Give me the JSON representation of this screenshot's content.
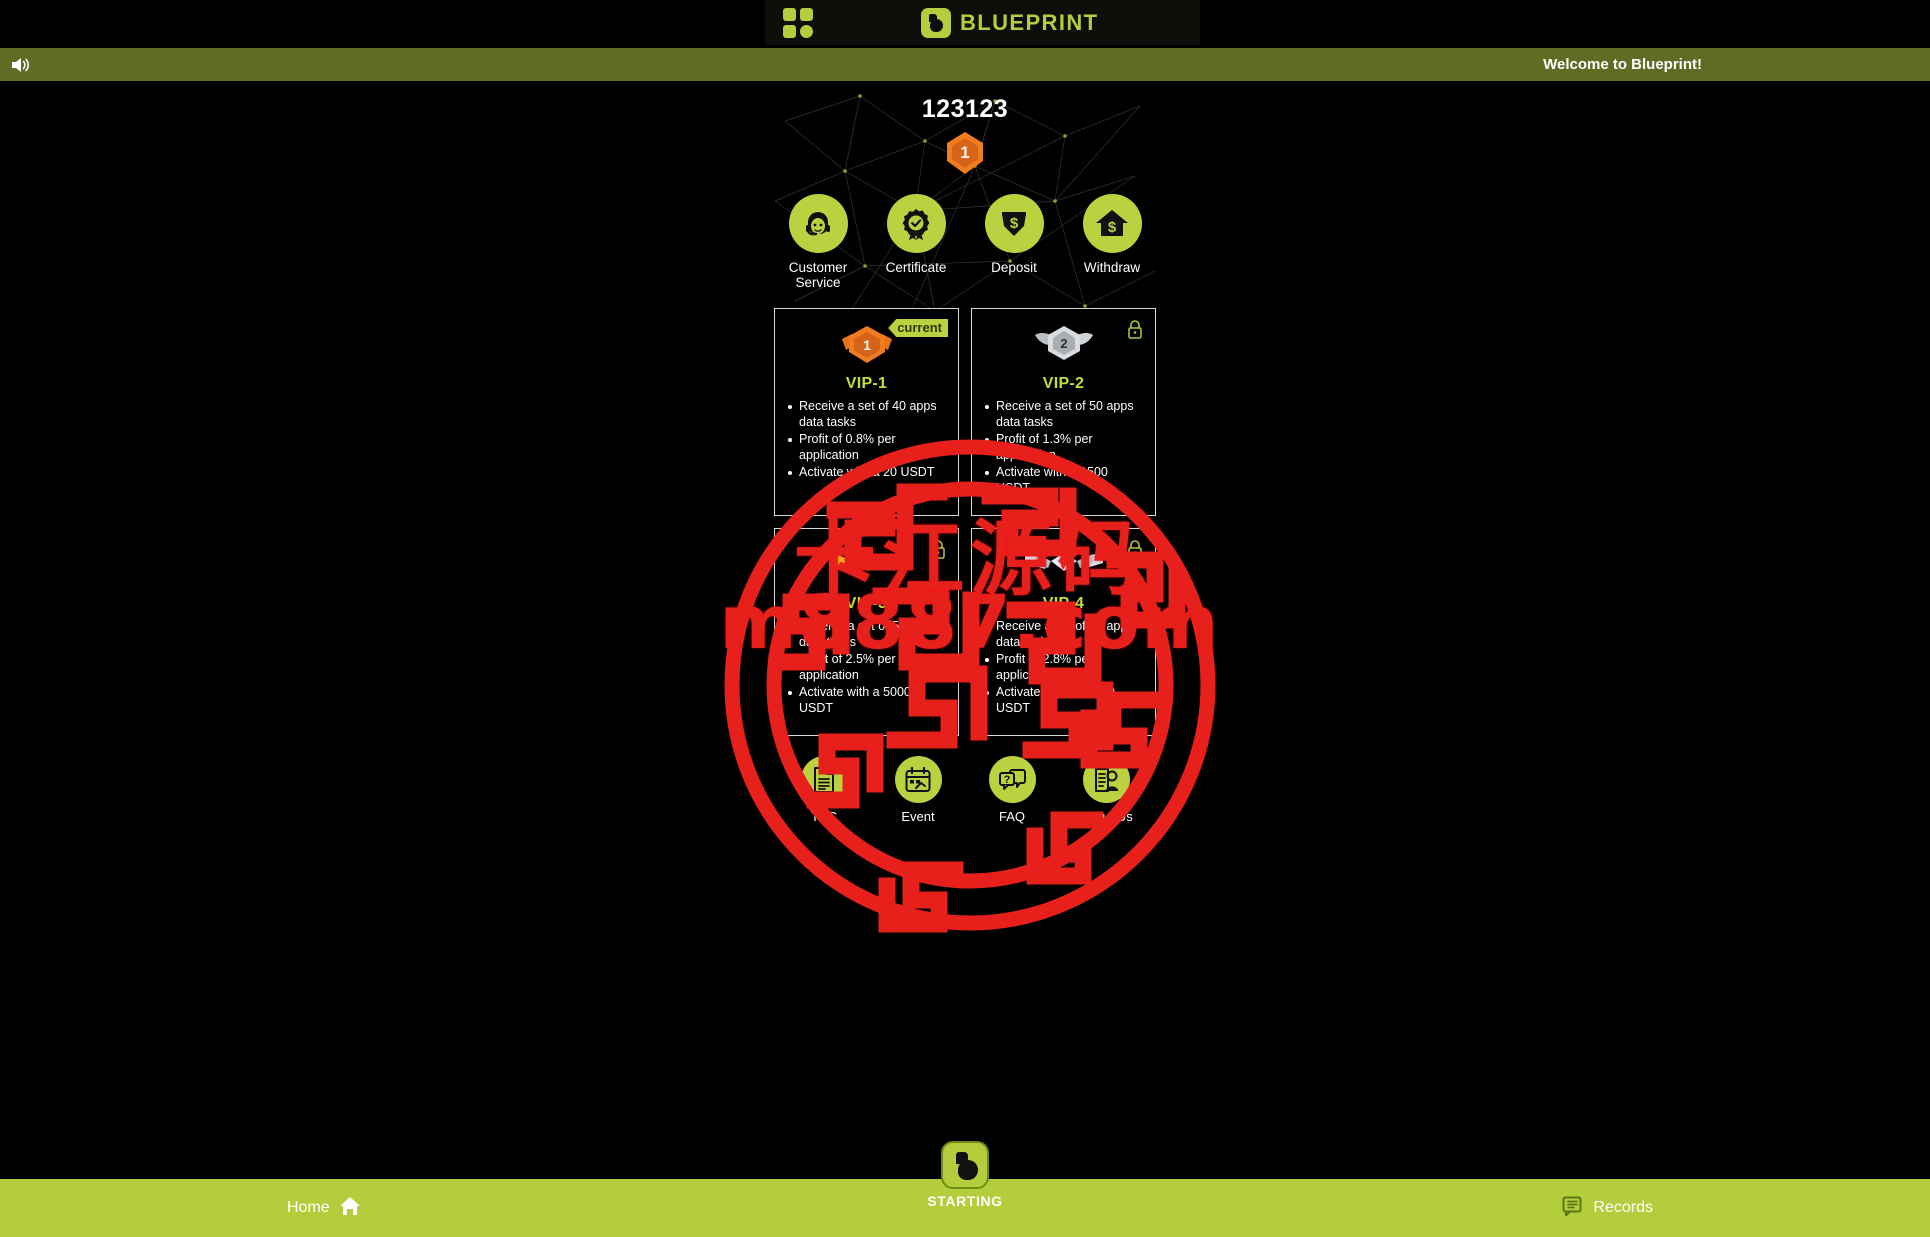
{
  "header": {
    "apps_icon": "grid-apps-icon",
    "brand_name": "BLUEPRINT",
    "brand_icon": "blueprint-logo-icon"
  },
  "marquee": {
    "speaker_icon": "speaker-icon",
    "text": "Welcome to Blueprint!"
  },
  "profile": {
    "username": "123123",
    "rank_icon": "vip-rank-1-badge",
    "rank_level": "1"
  },
  "quick_actions": [
    {
      "label": "Customer Service",
      "icon": "customer-service-icon"
    },
    {
      "label": "Certificate",
      "icon": "certificate-icon"
    },
    {
      "label": "Deposit",
      "icon": "deposit-icon"
    },
    {
      "label": "Withdraw",
      "icon": "withdraw-icon"
    }
  ],
  "vip_levels": [
    {
      "title": "VIP-1",
      "state": "current",
      "state_label": "current",
      "medal": "bronze-medal-1",
      "benefits": [
        "Receive a set of 40 apps data tasks",
        "Profit of 0.8% per application",
        "Activate with a 20 USDT"
      ]
    },
    {
      "title": "VIP-2",
      "state": "locked",
      "state_label": "",
      "medal": "silver-medal-2",
      "benefits": [
        "Receive a set of 50 apps data tasks",
        "Profit of 1.3% per application",
        "Activate with a 1500 USDT"
      ]
    },
    {
      "title": "VIP-3",
      "state": "locked",
      "state_label": "",
      "medal": "gold-medal-3",
      "benefits": [
        "Receive a set of 55 apps data tasks",
        "Profit of 2.5% per application",
        "Activate with a 5000 USDT"
      ]
    },
    {
      "title": "VIP-4",
      "state": "locked",
      "state_label": "",
      "medal": "platinum-medal-4",
      "benefits": [
        "Receive a set of 60 apps data tasks",
        "Profit of 2.8% per application",
        "Activate with a 10000 USDT"
      ]
    }
  ],
  "info_actions": [
    {
      "label": "T&C",
      "icon": "terms-document-icon"
    },
    {
      "label": "Event",
      "icon": "calendar-event-icon"
    },
    {
      "label": "FAQ",
      "icon": "faq-chat-icon"
    },
    {
      "label": "About Us",
      "icon": "about-us-icon"
    }
  ],
  "bottom_nav": {
    "home_label": "Home",
    "home_icon": "home-icon",
    "start_label": "STARTING",
    "start_icon": "blueprint-logo-icon",
    "records_label": "Records",
    "records_icon": "records-icon"
  },
  "watermark": {
    "chinese_text": "卡江源码",
    "url_text": "m8887.com",
    "color": "#e8201c"
  },
  "colors": {
    "brand_green": "#b5cc3c",
    "banner_olive": "#606b24",
    "nav_green": "#b3cd3d",
    "vip_title": "#c6de3a",
    "background": "#000000"
  }
}
